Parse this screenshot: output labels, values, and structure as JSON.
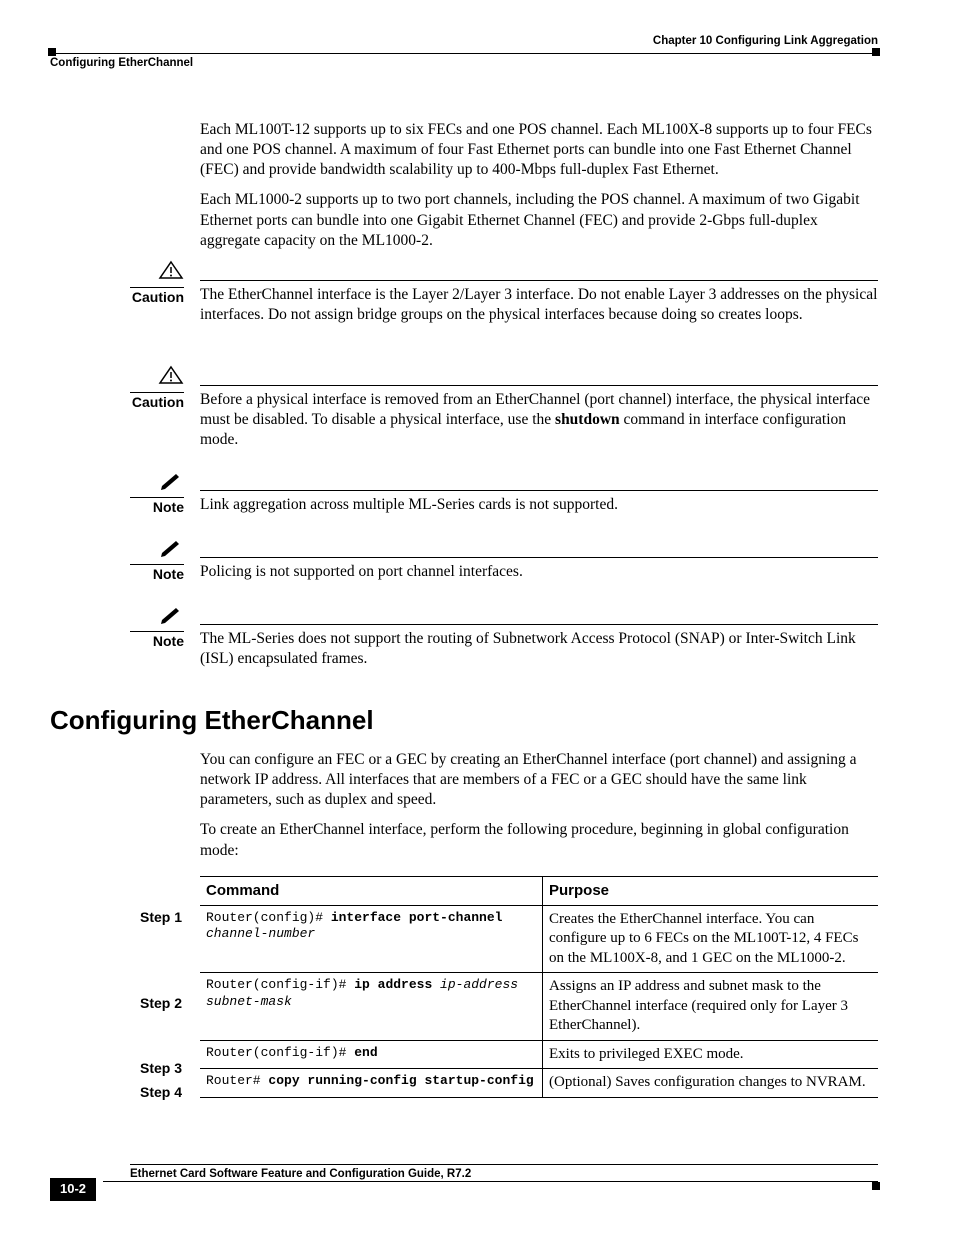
{
  "header": {
    "chapter": "Chapter 10  Configuring Link Aggregation",
    "section": "Configuring EtherChannel"
  },
  "intro": {
    "p1": "Each ML100T-12 supports up to six FECs and one POS channel. Each ML100X-8 supports up to four FECs and one POS channel. A maximum of four Fast Ethernet ports can bundle into one Fast Ethernet Channel (FEC) and provide bandwidth scalability up to 400-Mbps full-duplex Fast Ethernet.",
    "p2": "Each ML1000-2 supports up to two port channels, including the POS channel. A maximum of two Gigabit Ethernet ports can bundle into one Gigabit Ethernet Channel (FEC) and provide 2-Gbps full-duplex aggregate capacity on the ML1000-2."
  },
  "callouts": {
    "caution1_label": "Caution",
    "caution1_text": "The EtherChannel interface is the Layer 2/Layer 3 interface. Do not enable Layer 3 addresses on the physical interfaces. Do not assign bridge groups on the physical interfaces because doing so creates loops.",
    "caution2_label": "Caution",
    "caution2_pre": "Before a physical interface is removed from an EtherChannel (port channel) interface, the physical interface must be disabled. To disable a physical interface, use the ",
    "caution2_bold": "shutdown",
    "caution2_post": " command in interface configuration mode.",
    "note1_label": "Note",
    "note1_text": "Link aggregation across multiple ML-Series cards is not supported.",
    "note2_label": "Note",
    "note2_text": "Policing is not supported on port channel interfaces.",
    "note3_label": "Note",
    "note3_text": "The ML-Series does not support the routing of Subnetwork Access Protocol (SNAP) or Inter-Switch Link (ISL) encapsulated frames."
  },
  "heading": "Configuring EtherChannel",
  "sect": {
    "p1": "You can configure an FEC or a GEC by creating an EtherChannel interface (port channel) and assigning a network IP address. All interfaces that are members of a FEC or a GEC should have the same link parameters, such as duplex and speed.",
    "p2": "To create an EtherChannel interface, perform the following procedure, beginning in global configuration mode:"
  },
  "table": {
    "h1": "Command",
    "h2": "Purpose",
    "rows": [
      {
        "step": "Step 1",
        "prompt": "Router(config)# ",
        "bold": "interface port-channel",
        "ital": " channel-number",
        "purpose": "Creates the EtherChannel interface. You can configure up to 6 FECs on the ML100T-12, 4 FECs on the ML100X-8, and 1 GEC on the ML1000-2."
      },
      {
        "step": "Step 2",
        "prompt": "Router(config-if)# ",
        "bold": "ip address",
        "ital": " ip-address subnet-mask",
        "purpose": "Assigns an IP address and subnet mask to the EtherChannel interface (required only for Layer 3 EtherChannel)."
      },
      {
        "step": "Step 3",
        "prompt": "Router(config-if)# ",
        "bold": "end",
        "ital": "",
        "purpose": "Exits to privileged EXEC mode."
      },
      {
        "step": "Step 4",
        "prompt": "Router# ",
        "bold": "copy running-config startup-config",
        "ital": "",
        "purpose": "(Optional) Saves configuration changes to NVRAM."
      }
    ]
  },
  "footer": {
    "title": "Ethernet Card Software Feature and Configuration Guide, R7.2",
    "pagenum": "10-2"
  }
}
